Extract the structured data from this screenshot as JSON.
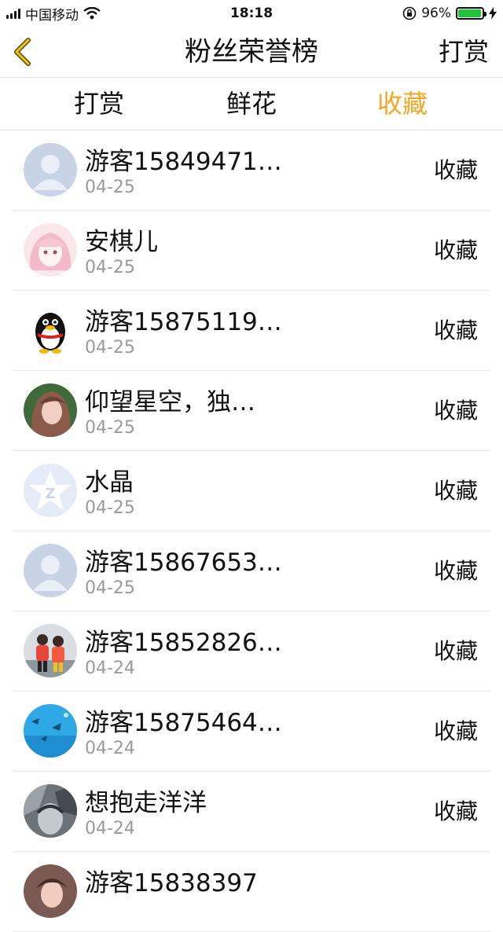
{
  "status": {
    "carrier": "中国移动",
    "time": "18:18",
    "battery_percent": "96%",
    "battery_level": 0.96,
    "battery_color": "#22c33a"
  },
  "nav": {
    "back_icon": "chevron-left-icon",
    "title": "粉丝荣誉榜",
    "right_label": "打赏"
  },
  "tabs": [
    {
      "label": "打赏",
      "active": false
    },
    {
      "label": "鲜花",
      "active": false
    },
    {
      "label": "收藏",
      "active": true
    }
  ],
  "accent_color": "#f5a623",
  "list": [
    {
      "name": "游客15849471…",
      "date": "04-25",
      "action": "收藏",
      "avatar": "default-avatar"
    },
    {
      "name": "安棋儿",
      "date": "04-25",
      "action": "收藏",
      "avatar": "anime-girl-avatar"
    },
    {
      "name": "游客15875119…",
      "date": "04-25",
      "action": "收藏",
      "avatar": "penguin-avatar"
    },
    {
      "name": "仰望星空，独…",
      "date": "04-25",
      "action": "收藏",
      "avatar": "portrait-avatar"
    },
    {
      "name": "水晶",
      "date": "04-25",
      "action": "收藏",
      "avatar": "star-avatar"
    },
    {
      "name": "游客15867653…",
      "date": "04-25",
      "action": "收藏",
      "avatar": "default-avatar"
    },
    {
      "name": "游客15852826…",
      "date": "04-24",
      "action": "收藏",
      "avatar": "kids-photo-avatar"
    },
    {
      "name": "游客15875464…",
      "date": "04-24",
      "action": "收藏",
      "avatar": "ocean-avatar"
    },
    {
      "name": "想抱走洋洋",
      "date": "04-24",
      "action": "收藏",
      "avatar": "grey-photo-avatar"
    },
    {
      "name": "游客15838397",
      "date": "",
      "action": "",
      "avatar": "portrait-avatar"
    }
  ]
}
